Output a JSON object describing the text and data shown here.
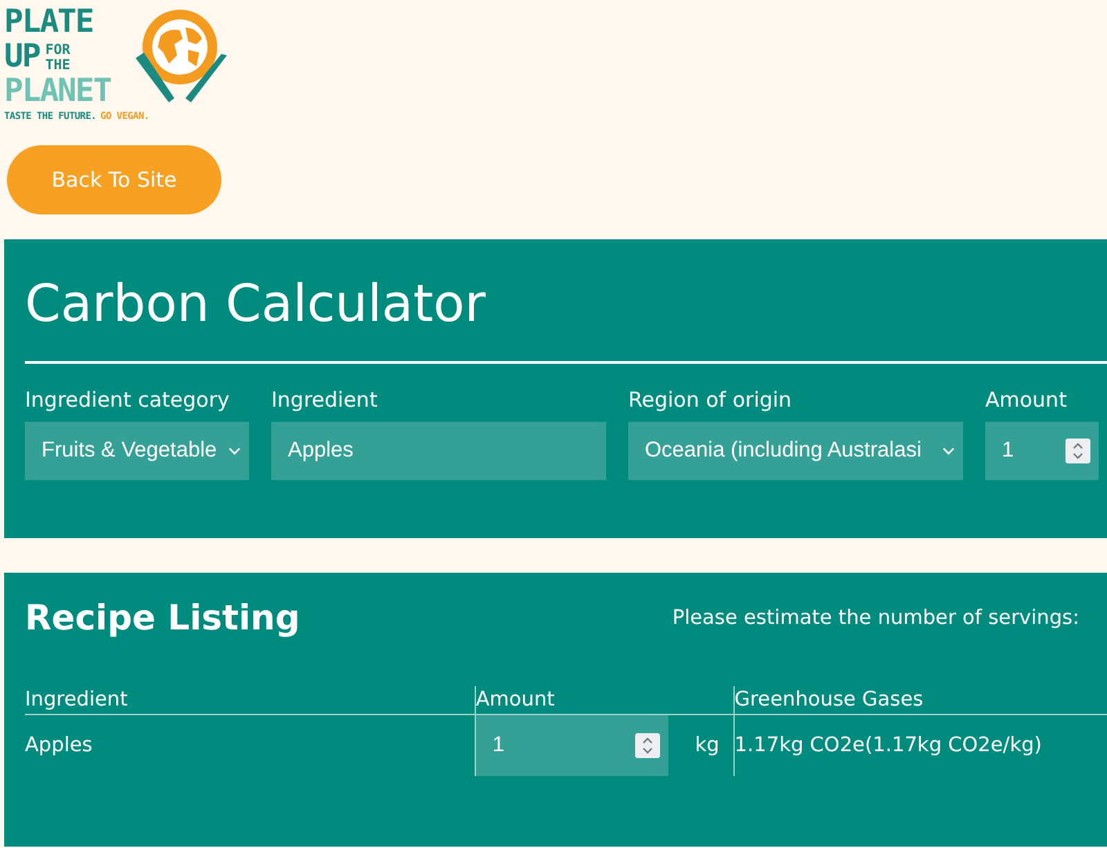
{
  "logo": {
    "line_1": "PLATE",
    "line_2": "UP",
    "line_2_small": [
      "FOR",
      "THE"
    ],
    "line_3": "PLANET",
    "tagline": "TASTE THE FUTURE.",
    "tagline_accent": "GO VEGAN."
  },
  "back_button": {
    "label": "Back To Site"
  },
  "calculator": {
    "title": "Carbon Calculator",
    "fields": [
      {
        "kind": "select",
        "label": "Ingredient category",
        "value": "Fruits & Vegetable"
      },
      {
        "kind": "text",
        "label": "Ingredient",
        "value": "Apples"
      },
      {
        "kind": "select",
        "label": "Region of origin",
        "value": "Oceania (including Australasi"
      },
      {
        "kind": "number",
        "label": "Amount",
        "value": "1"
      }
    ]
  },
  "recipe": {
    "title": "Recipe Listing",
    "servings_prompt": "Please estimate the number of servings:",
    "columns": [
      "Ingredient",
      "Amount",
      "Greenhouse Gases"
    ],
    "rows": [
      {
        "ingredient": "Apples",
        "amount": "1",
        "unit": "kg",
        "gases": "1.17kg CO2e(1.17kg CO2e/kg)"
      }
    ]
  }
}
